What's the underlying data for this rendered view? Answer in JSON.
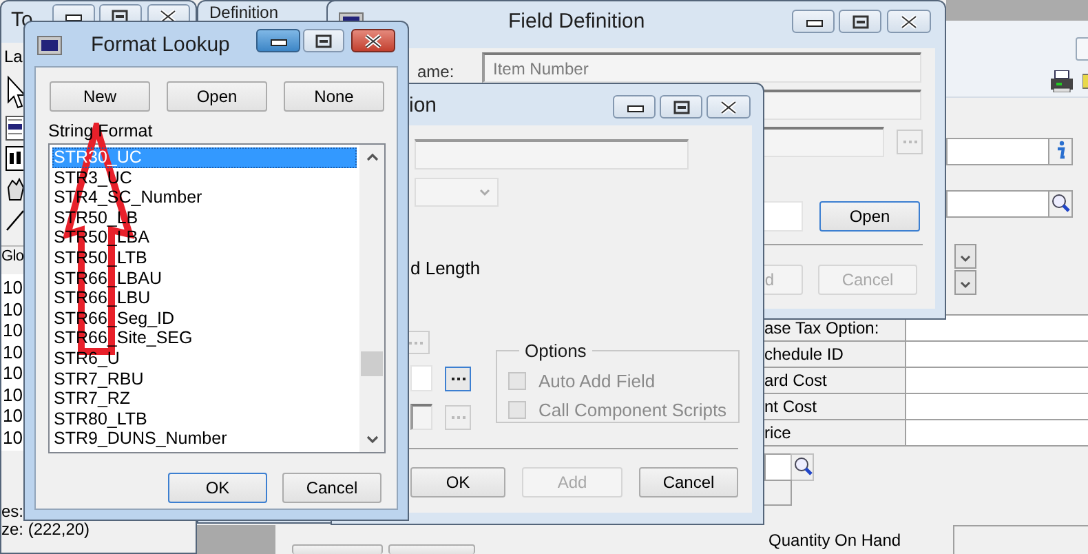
{
  "app_window": {
    "table_rows": [
      "ase Tax Option:",
      "chedule ID",
      "ard Cost",
      "nt Cost",
      "rice"
    ],
    "quantity_label": "Quantity On Hand"
  },
  "tools_window": {
    "title": "To",
    "label": "La",
    "tab": "Glo",
    "rows": [
      "10",
      "10",
      "10",
      "10",
      "10",
      "10",
      "10",
      "10"
    ],
    "status_lines": [
      "es:",
      "ze: (222,20)"
    ]
  },
  "definition_window": {
    "title": "Definition"
  },
  "field_definition": {
    "title": "Field Definition",
    "name_label": "ame:",
    "name_value": "Item Number",
    "buttons": [
      {
        "label": "Open",
        "disabled": false
      },
      {
        "label": "d",
        "disabled": true
      },
      {
        "label": "Cancel",
        "disabled": true
      }
    ]
  },
  "format_window": {
    "title": "ion",
    "length_label": "d Length",
    "options": {
      "title": "Options",
      "items": [
        {
          "label": "Auto Add Field",
          "checked": false,
          "disabled": true
        },
        {
          "label": "Call Component Scripts",
          "checked": false,
          "disabled": true
        }
      ]
    },
    "buttons": [
      {
        "label": "OK",
        "disabled": false
      },
      {
        "label": "Add",
        "disabled": true
      },
      {
        "label": "Cancel",
        "disabled": false
      }
    ]
  },
  "format_lookup": {
    "title": "Format Lookup",
    "top_buttons": [
      "New",
      "Open",
      "None"
    ],
    "list_label": "String Format",
    "items": [
      {
        "label": "STR30_UC",
        "selected": true
      },
      {
        "label": "STR3_UC",
        "selected": false
      },
      {
        "label": "STR4_SC_Number",
        "selected": false
      },
      {
        "label": "STR50_LB",
        "selected": false
      },
      {
        "label": "STR50_LBA",
        "selected": false
      },
      {
        "label": "STR50_LTB",
        "selected": false
      },
      {
        "label": "STR66_LBAU",
        "selected": false
      },
      {
        "label": "STR66_LBU",
        "selected": false
      },
      {
        "label": "STR66_Seg_ID",
        "selected": false
      },
      {
        "label": "STR66_Site_SEG",
        "selected": false
      },
      {
        "label": "STR6_U",
        "selected": false
      },
      {
        "label": "STR7_RBU",
        "selected": false
      },
      {
        "label": "STR7_RZ",
        "selected": false
      },
      {
        "label": "STR80_LTB",
        "selected": false
      },
      {
        "label": "STR9_DUNS_Number",
        "selected": false
      }
    ],
    "bottom_buttons": [
      "OK",
      "Cancel"
    ]
  }
}
